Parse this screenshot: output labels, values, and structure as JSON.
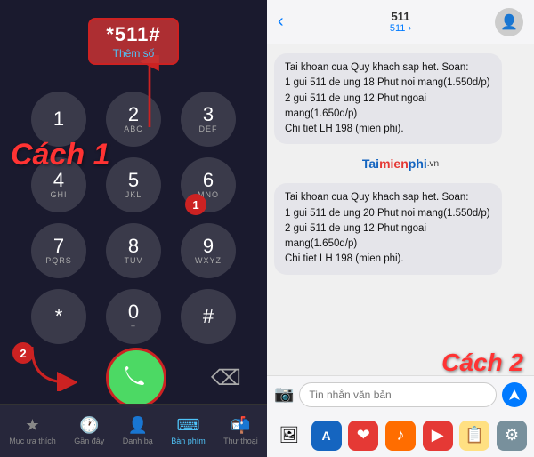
{
  "left": {
    "dialer_number": "*511#",
    "dialer_add_label": "Thêm số",
    "cach1_label": "Cách 1",
    "circle1_label": "1",
    "circle2_label": "2",
    "keys": [
      {
        "num": "1",
        "letters": ""
      },
      {
        "num": "2",
        "letters": "ABC"
      },
      {
        "num": "3",
        "letters": "DEF"
      },
      {
        "num": "4",
        "letters": "GHI"
      },
      {
        "num": "5",
        "letters": "JKL"
      },
      {
        "num": "6",
        "letters": "MNO"
      },
      {
        "num": "7",
        "letters": "PQRS"
      },
      {
        "num": "8",
        "letters": "TUV"
      },
      {
        "num": "9",
        "letters": "WXYZ"
      },
      {
        "num": "*",
        "letters": ""
      },
      {
        "num": "0",
        "letters": "+"
      },
      {
        "num": "#",
        "letters": ""
      }
    ],
    "nav_items": [
      {
        "label": "Mục ưa thích",
        "icon": "★",
        "active": false
      },
      {
        "label": "Gần đây",
        "icon": "🕐",
        "active": false
      },
      {
        "label": "Danh bạ",
        "icon": "👤",
        "active": false
      },
      {
        "label": "Bàn phím",
        "icon": "⌨",
        "active": true
      },
      {
        "label": "Thư thoại",
        "icon": "📬",
        "active": false
      }
    ]
  },
  "right": {
    "header": {
      "contact_name": "511",
      "contact_detail": "511 ›",
      "back_icon": "‹"
    },
    "messages": [
      {
        "text": "Tai khoan cua Quy khach sap het. Soan:\n1 gui 511 de ung 18 Phut noi mang(1.550d/p)\n2 gui 511 de ung 12 Phut ngoai mang(1.650d/p)\nChi tiet LH 198 (mien phi)."
      },
      {
        "text": "Tai khoan cua Quy khach sap het. Soan:\n1 gui 511 de ung 20 Phut noi mang(1.550d/p)\n2 gui 511 de ung 12 Phut ngoai mang(1.650d/p)\nChi tiet LH 198 (mien phi)."
      }
    ],
    "logo_text": "Taimienphi",
    "logo_vn": ".vn",
    "cach2_label": "Cách 2",
    "input_placeholder": "Tin nhắn văn bản",
    "camera_icon": "📷",
    "send_icon": "▲",
    "dock_icons": [
      "🖼",
      "🅐",
      "❤",
      "♪",
      "▶",
      "🗒",
      "⚙"
    ]
  }
}
